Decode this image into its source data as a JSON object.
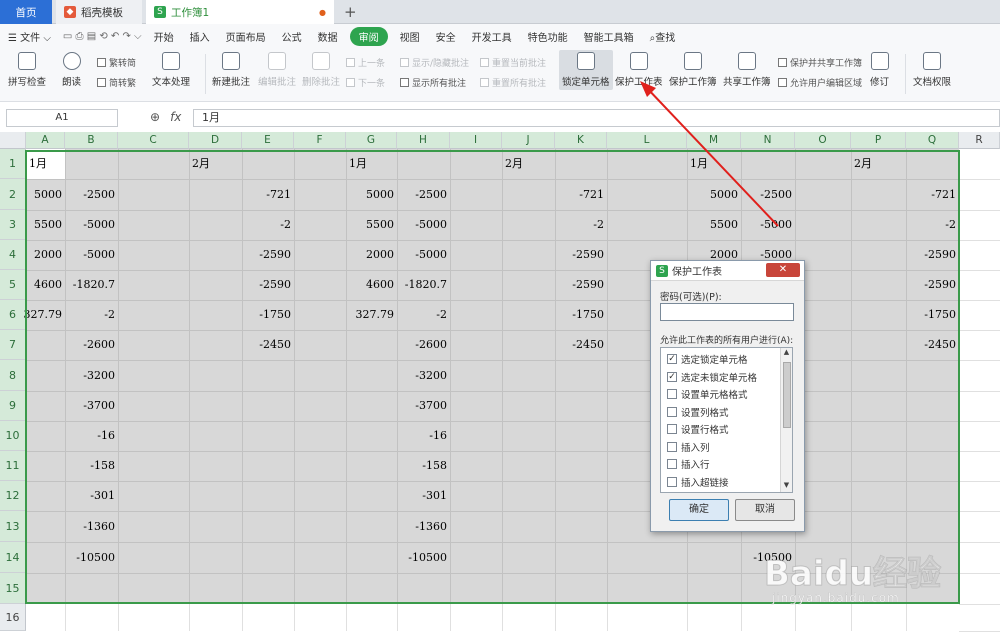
{
  "tabs": [
    {
      "label": "首页"
    },
    {
      "label": "稻壳模板"
    },
    {
      "label": "工作簿1"
    }
  ],
  "new_tab": "+",
  "menu": {
    "file": "文件",
    "items": [
      "开始",
      "插入",
      "页面布局",
      "公式",
      "数据",
      "审阅",
      "视图",
      "安全",
      "开发工具",
      "特色功能",
      "智能工具箱"
    ],
    "active": "审阅",
    "search": "查找"
  },
  "ribbon": {
    "spellcheck": "拼写检查",
    "read": "朗读",
    "trad_to_simp": "繁转简",
    "simp_to_trad": "简转繁",
    "text_process": "文本处理",
    "new_comment": "新建批注",
    "edit_comment": "编辑批注",
    "delete_comment": "删除批注",
    "prev": "上一条",
    "next": "下一条",
    "show_hide_comment": "显示/隐藏批注",
    "show_all_comments": "显示所有批注",
    "reset_current": "重置当前批注",
    "reset_all": "重置所有批注",
    "lock_cells": "锁定单元格",
    "protect_sheet": "保护工作表",
    "protect_workbook": "保护工作簿",
    "share_workbook": "共享工作簿",
    "protect_shared": "保护并共享工作簿",
    "allow_edit": "允许用户编辑区域",
    "track_changes": "修订",
    "doc_rights": "文档权限"
  },
  "formula_bar": {
    "name_box": "A1",
    "fx": "fx",
    "formula": "1月"
  },
  "columns": [
    "A",
    "B",
    "C",
    "D",
    "E",
    "F",
    "G",
    "H",
    "I",
    "J",
    "K",
    "L",
    "M",
    "N",
    "O",
    "P",
    "Q",
    "R"
  ],
  "rows": [
    "1",
    "2",
    "3",
    "4",
    "5",
    "6",
    "7",
    "8",
    "9",
    "10",
    "11",
    "12",
    "13",
    "14",
    "15",
    "16"
  ],
  "cells": {
    "A1": "1月",
    "D1": "2月",
    "G1": "1月",
    "J1": "2月",
    "M1": "1月",
    "P1": "2月",
    "A2": "5000",
    "B2": "-2500",
    "E2": "-721",
    "G2": "5000",
    "H2": "-2500",
    "K2": "-721",
    "M2": "5000",
    "N2": "-2500",
    "Q2": "-721",
    "A3": "5500",
    "B3": "-5000",
    "E3": "-2",
    "G3": "5500",
    "H3": "-5000",
    "K3": "-2",
    "M3": "5500",
    "N3": "-5000",
    "Q3": "-2",
    "A4": "2000",
    "B4": "-5000",
    "E4": "-2590",
    "G4": "2000",
    "H4": "-5000",
    "K4": "-2590",
    "M4": "2000",
    "N4": "-5000",
    "Q4": "-2590",
    "A5": "4600",
    "B5": "-1820.7",
    "E5": "-2590",
    "G5": "4600",
    "H5": "-1820.7",
    "K5": "-2590",
    "Q5": "-2590",
    "A6": "327.79",
    "B6": "-2",
    "E6": "-1750",
    "G6": "327.79",
    "H6": "-2",
    "K6": "-1750",
    "Q6": "-1750",
    "B7": "-2600",
    "E7": "-2450",
    "H7": "-2600",
    "K7": "-2450",
    "Q7": "-2450",
    "B8": "-3200",
    "H8": "-3200",
    "B9": "-3700",
    "H9": "-3700",
    "B10": "-16",
    "H10": "-16",
    "B11": "-158",
    "H11": "-158",
    "B12": "-301",
    "H12": "-301",
    "B13": "-1360",
    "H13": "-1360",
    "B14": "-10500",
    "H14": "-10500",
    "N14": "-10500"
  },
  "dialog": {
    "title": "保护工作表",
    "close": "✕",
    "password_label": "密码(可选)(P):",
    "password_value": "",
    "permissions_label": "允许此工作表的所有用户进行(A):",
    "permissions": [
      {
        "label": "选定锁定单元格",
        "checked": true
      },
      {
        "label": "选定未锁定单元格",
        "checked": true
      },
      {
        "label": "设置单元格格式",
        "checked": false
      },
      {
        "label": "设置列格式",
        "checked": false
      },
      {
        "label": "设置行格式",
        "checked": false
      },
      {
        "label": "插入列",
        "checked": false
      },
      {
        "label": "插入行",
        "checked": false
      },
      {
        "label": "插入超链接",
        "checked": false
      }
    ],
    "ok": "确定",
    "cancel": "取消"
  },
  "watermark": {
    "brand": "Baidu经验",
    "url": "jingyan.baidu.com"
  },
  "colors": {
    "accent_green": "#2ea44f",
    "selection_border": "#3a9a4a",
    "arrow": "#e0201c",
    "home_tab": "#2c6fd6"
  }
}
